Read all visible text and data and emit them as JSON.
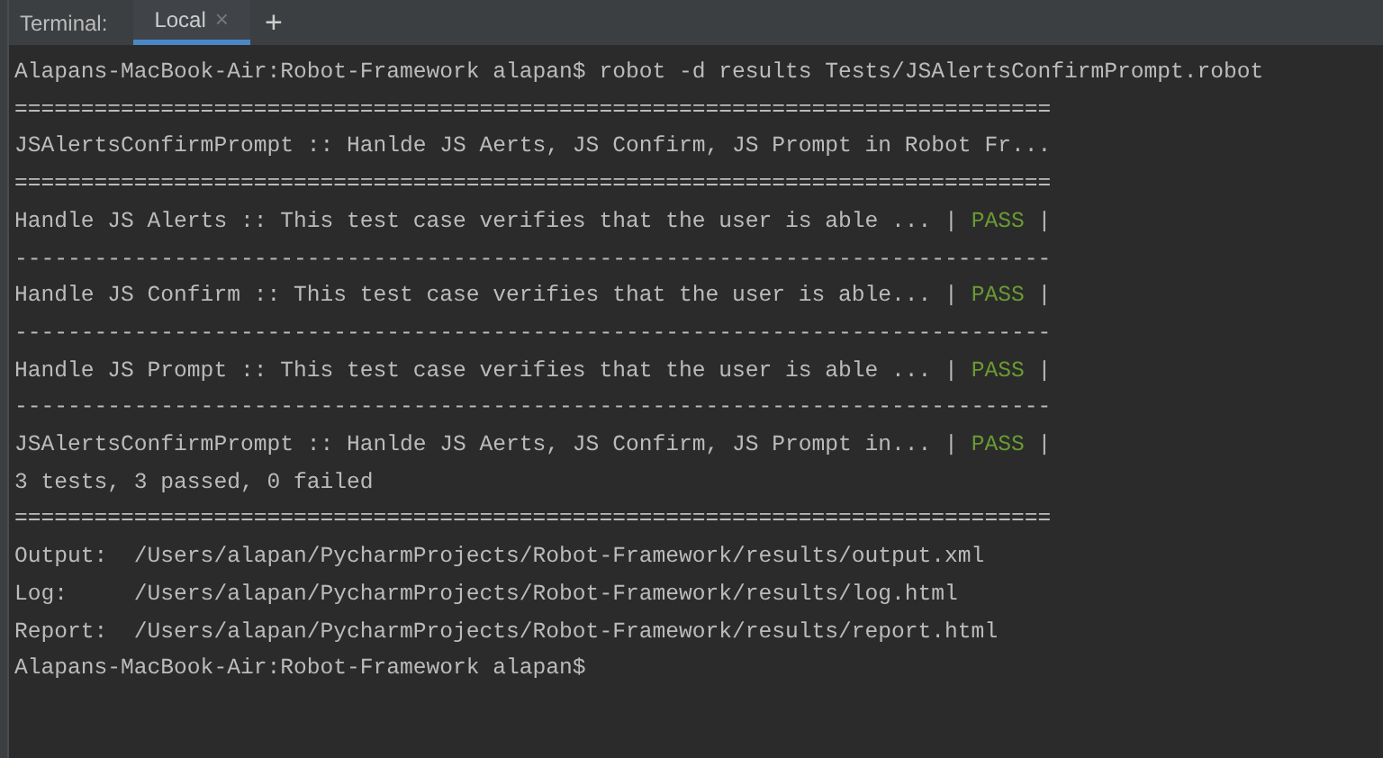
{
  "toolbar": {
    "title": "Terminal:",
    "tabs": [
      {
        "label": "Local",
        "selected": true,
        "close": "×"
      }
    ],
    "add": "+"
  },
  "lines": [
    {
      "kind": "text",
      "text": "Alapans-MacBook-Air:Robot-Framework alapan$ robot -d results Tests/JSAlertsConfirmPrompt.robot"
    },
    {
      "kind": "rule",
      "text": "=============================================================================="
    },
    {
      "kind": "text",
      "text": "JSAlertsConfirmPrompt :: Hanlde JS Aerts, JS Confirm, JS Prompt in Robot Fr..."
    },
    {
      "kind": "rule",
      "text": "=============================================================================="
    },
    {
      "kind": "result",
      "text": "Handle JS Alerts :: This test case verifies that the user is able ... | ",
      "status": "PASS",
      "end": " |"
    },
    {
      "kind": "rule",
      "text": "------------------------------------------------------------------------------"
    },
    {
      "kind": "result",
      "text": "Handle JS Confirm :: This test case verifies that the user is able... | ",
      "status": "PASS",
      "end": " |"
    },
    {
      "kind": "rule",
      "text": "------------------------------------------------------------------------------"
    },
    {
      "kind": "result",
      "text": "Handle JS Prompt :: This test case verifies that the user is able ... | ",
      "status": "PASS",
      "end": " |"
    },
    {
      "kind": "rule",
      "text": "------------------------------------------------------------------------------"
    },
    {
      "kind": "result",
      "text": "JSAlertsConfirmPrompt :: Hanlde JS Aerts, JS Confirm, JS Prompt in... | ",
      "status": "PASS",
      "end": " |"
    },
    {
      "kind": "text",
      "text": "3 tests, 3 passed, 0 failed"
    },
    {
      "kind": "rule",
      "text": "=============================================================================="
    },
    {
      "kind": "text",
      "text": "Output:  /Users/alapan/PycharmProjects/Robot-Framework/results/output.xml"
    },
    {
      "kind": "text",
      "text": "Log:     /Users/alapan/PycharmProjects/Robot-Framework/results/log.html"
    },
    {
      "kind": "text",
      "text": "Report:  /Users/alapan/PycharmProjects/Robot-Framework/results/report.html"
    },
    {
      "kind": "text",
      "text": "Alapans-MacBook-Air:Robot-Framework alapan$"
    }
  ]
}
